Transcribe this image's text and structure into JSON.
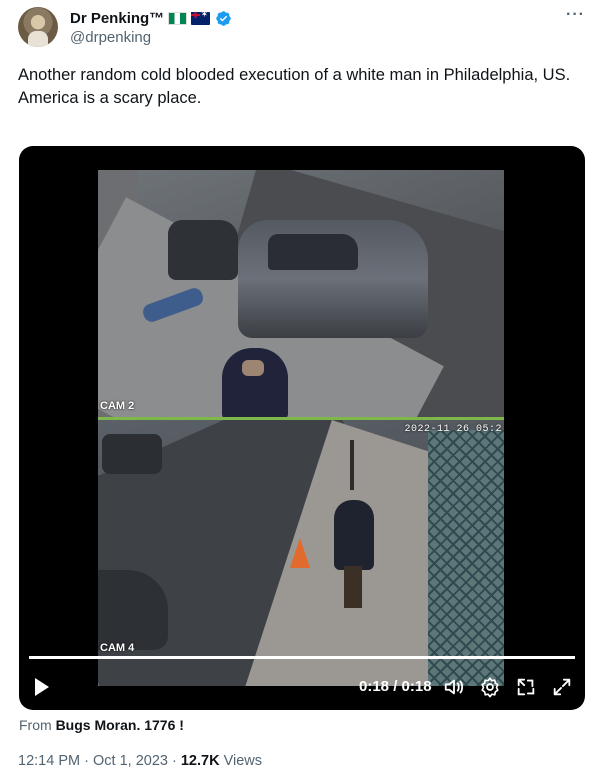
{
  "author": {
    "display_name": "Dr Penking™",
    "handle": "@drpenking"
  },
  "icons": {
    "more": "more-horizontal-icon",
    "verified": "verified-badge-icon",
    "flags": [
      "nigeria-flag",
      "australia-flag"
    ]
  },
  "tweet": {
    "text": "Another random cold blooded execution of a white man in Philadelphia, US.\nAmerica is a scary place."
  },
  "video": {
    "cam_top_label": "CAM 2",
    "cam_bottom_label": "CAM 4",
    "timestamp_overlay": "2022-11 26 05:2",
    "time_display": "0:18 / 0:18",
    "progress": 1.0
  },
  "source": {
    "prefix": "From",
    "name": "Bugs Moran. 1776 !"
  },
  "meta": {
    "time": "12:14 PM",
    "separator": "·",
    "date": "Oct 1, 2023",
    "views_count": "12.7K",
    "views_label": "Views"
  },
  "colors": {
    "verified": "#1d9bf0",
    "secondary_text": "#536471",
    "primary_text": "#0f1419"
  }
}
